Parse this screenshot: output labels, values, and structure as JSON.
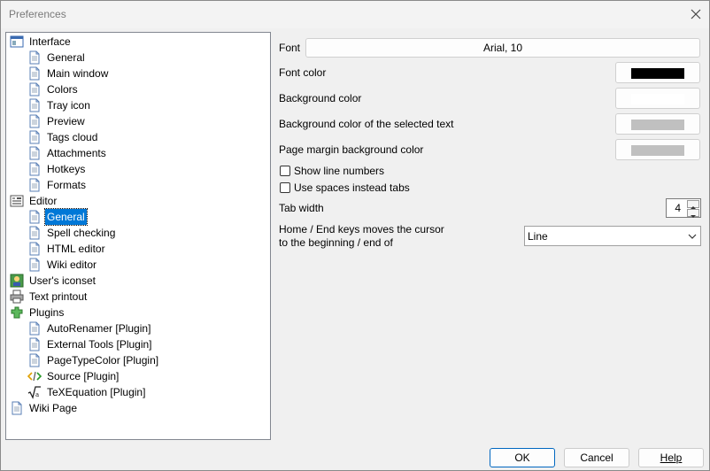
{
  "window": {
    "title": "Preferences"
  },
  "tree": [
    {
      "label": "Interface",
      "icon": "interface-icon",
      "indent": 0
    },
    {
      "label": "General",
      "icon": "page-icon",
      "indent": 1
    },
    {
      "label": "Main window",
      "icon": "page-icon",
      "indent": 1
    },
    {
      "label": "Colors",
      "icon": "page-icon",
      "indent": 1
    },
    {
      "label": "Tray icon",
      "icon": "page-icon",
      "indent": 1
    },
    {
      "label": "Preview",
      "icon": "page-icon",
      "indent": 1
    },
    {
      "label": "Tags cloud",
      "icon": "page-icon",
      "indent": 1
    },
    {
      "label": "Attachments",
      "icon": "page-icon",
      "indent": 1
    },
    {
      "label": "Hotkeys",
      "icon": "page-icon",
      "indent": 1
    },
    {
      "label": "Formats",
      "icon": "page-icon",
      "indent": 1
    },
    {
      "label": "Editor",
      "icon": "editor-icon",
      "indent": 0
    },
    {
      "label": "General",
      "icon": "page-icon",
      "indent": 1,
      "selected": true
    },
    {
      "label": "Spell checking",
      "icon": "page-icon",
      "indent": 1
    },
    {
      "label": "HTML editor",
      "icon": "page-icon",
      "indent": 1
    },
    {
      "label": "Wiki editor",
      "icon": "page-icon",
      "indent": 1
    },
    {
      "label": "User's iconset",
      "icon": "iconset-icon",
      "indent": 0
    },
    {
      "label": "Text printout",
      "icon": "printer-icon",
      "indent": 0
    },
    {
      "label": "Plugins",
      "icon": "plugins-icon",
      "indent": 0
    },
    {
      "label": "AutoRenamer [Plugin]",
      "icon": "page-icon",
      "indent": 1
    },
    {
      "label": "External Tools [Plugin]",
      "icon": "page-icon",
      "indent": 1
    },
    {
      "label": "PageTypeColor [Plugin]",
      "icon": "page-icon",
      "indent": 1
    },
    {
      "label": "Source [Plugin]",
      "icon": "code-icon",
      "indent": 1
    },
    {
      "label": "TeXEquation [Plugin]",
      "icon": "sqrt-icon",
      "indent": 1
    },
    {
      "label": "Wiki Page",
      "icon": "page-icon",
      "indent": 0
    }
  ],
  "editor": {
    "font_label": "Font",
    "font_value": "Arial, 10",
    "font_color_label": "Font color",
    "font_color": "#000000",
    "bg_color_label": "Background color",
    "bg_color": "#ffffff",
    "selected_bg_label": "Background color of the selected text",
    "selected_bg_color": "#c0c0c0",
    "margin_bg_label": "Page margin background color",
    "margin_bg_color": "#c0c0c0",
    "show_line_numbers_label": "Show line numbers",
    "show_line_numbers": false,
    "use_spaces_label": "Use spaces instead tabs",
    "use_spaces": false,
    "tab_width_label": "Tab width",
    "tab_width": "4",
    "home_end_label_1": "Home / End keys moves the cursor",
    "home_end_label_2": "to the beginning / end of",
    "home_end_value": "Line"
  },
  "buttons": {
    "ok": "OK",
    "cancel": "Cancel",
    "help": "Help"
  }
}
